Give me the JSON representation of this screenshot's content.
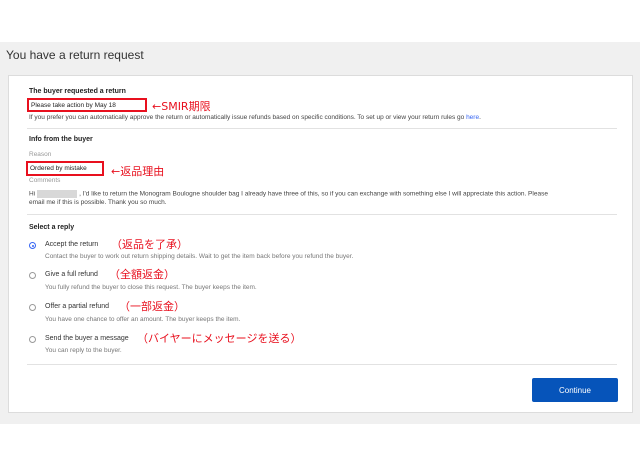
{
  "page_title": "You have a return request",
  "request": {
    "heading": "The buyer requested a return",
    "action_deadline": "Please take action by May 18",
    "deadline_annotation": "←SMIR期限",
    "rules_text": "If you prefer you can automatically approve the return or automatically issue refunds based on specific conditions. To set up or view your return rules go",
    "rules_link": "here",
    "rules_end": "."
  },
  "buyer_info": {
    "heading": "Info from the buyer",
    "reason_label": "Reason",
    "reason_value": "Ordered by mistake",
    "reason_annotation": "←返品理由",
    "comments_label": "Comments",
    "comment_greeting": "Hi",
    "comment_line1": ", I'd like to return the Monogram Boulogne shoulder bag I already have three of this, so if you can exchange with something else I will appreciate this action. Please",
    "comment_line2": "email me if this is possible. Thank you so much."
  },
  "reply": {
    "heading": "Select a reply",
    "options": [
      {
        "label": "Accept the return",
        "description": "Contact the buyer to work out return shipping details. Wait to get the item back before you refund the buyer.",
        "annotation": "（返品を了承）",
        "selected": true
      },
      {
        "label": "Give a full refund",
        "description": "You fully refund the buyer to close this request. The buyer keeps the item.",
        "annotation": "（全額返金）",
        "selected": false
      },
      {
        "label": "Offer a partial refund",
        "description": "You have one chance to offer an amount. The buyer keeps the item.",
        "annotation": "（一部返金）",
        "selected": false
      },
      {
        "label": "Send the buyer a message",
        "description": "You can reply to the buyer.",
        "annotation": "（バイヤーにメッセージを送る）",
        "selected": false
      }
    ]
  },
  "continue_label": "Continue",
  "colors": {
    "accent": "#3665f3",
    "button": "#0654ba",
    "annotation": "#e8101e"
  }
}
